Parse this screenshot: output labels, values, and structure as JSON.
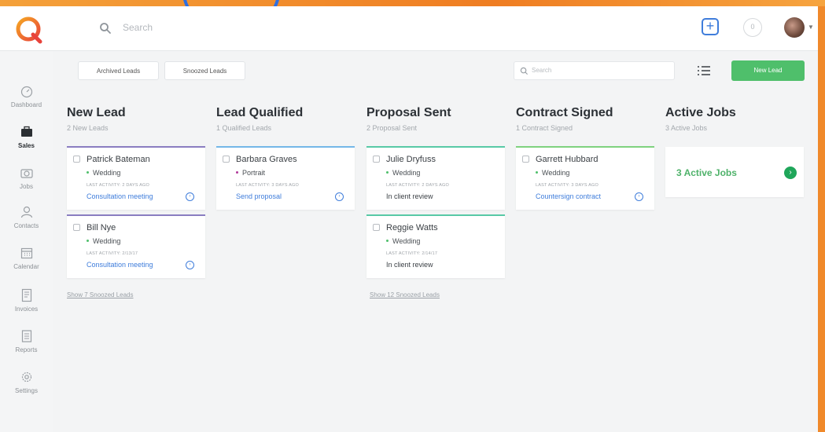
{
  "topbar": {
    "search_placeholder": "Search",
    "notification_count": "0"
  },
  "sidebar": {
    "items": [
      {
        "label": "Dashboard",
        "icon": "dashboard-icon",
        "active": false
      },
      {
        "label": "Sales",
        "icon": "briefcase-icon",
        "active": true
      },
      {
        "label": "Jobs",
        "icon": "camera-icon",
        "active": false
      },
      {
        "label": "Contacts",
        "icon": "person-icon",
        "active": false
      },
      {
        "label": "Calendar",
        "icon": "calendar-icon",
        "active": false
      },
      {
        "label": "Invoices",
        "icon": "invoice-icon",
        "active": false
      },
      {
        "label": "Reports",
        "icon": "report-icon",
        "active": false
      },
      {
        "label": "Settings",
        "icon": "gear-icon",
        "active": false
      }
    ]
  },
  "toolbar": {
    "archived_label": "Archived Leads",
    "snoozed_label": "Snoozed Leads",
    "search_placeholder": "Search",
    "new_lead_label": "New Lead"
  },
  "colors": {
    "accent_blue": "#3f7ddb",
    "accent_green": "#4fbf6b",
    "new_lead_border": "#8a7dc1",
    "qualified_border": "#74b7e8",
    "proposal_border": "#58c9a6",
    "contract_border": "#7fd27f"
  },
  "columns": [
    {
      "title": "New Lead",
      "subtitle": "2 New Leads",
      "snoozed_link": "Show 7 Snoozed Leads",
      "cards": [
        {
          "name": "Patrick Bateman",
          "tag": "Wedding",
          "activity": "LAST ACTIVITY: 2 DAYS AGO",
          "action": "Consultation meeting"
        },
        {
          "name": "Bill Nye",
          "tag": "Wedding",
          "activity": "LAST ACTIVITY: 2/13/17",
          "action": "Consultation meeting"
        }
      ]
    },
    {
      "title": "Lead Qualified",
      "subtitle": "1 Qualified Leads",
      "cards": [
        {
          "name": "Barbara Graves",
          "tag": "Portrait",
          "activity": "LAST ACTIVITY: 3 DAYS AGO",
          "action": "Send proposal"
        }
      ]
    },
    {
      "title": "Proposal Sent",
      "subtitle": "2 Proposal Sent",
      "snoozed_link": "Show 12 Snoozed Leads",
      "cards": [
        {
          "name": "Julie Dryfuss",
          "tag": "Wedding",
          "activity": "LAST ACTIVITY: 2 DAYS AGO",
          "status": "In client review"
        },
        {
          "name": "Reggie Watts",
          "tag": "Wedding",
          "activity": "LAST ACTIVITY: 2/14/17",
          "status": "In client review"
        }
      ]
    },
    {
      "title": "Contract Signed",
      "subtitle": "1 Contract Signed",
      "cards": [
        {
          "name": "Garrett Hubbard",
          "tag": "Wedding",
          "activity": "LAST ACTIVITY: 3 DAYS AGO",
          "action": "Countersign contract"
        }
      ]
    },
    {
      "title": "Active Jobs",
      "subtitle": "3 Active Jobs",
      "summary": "3 Active Jobs"
    }
  ]
}
